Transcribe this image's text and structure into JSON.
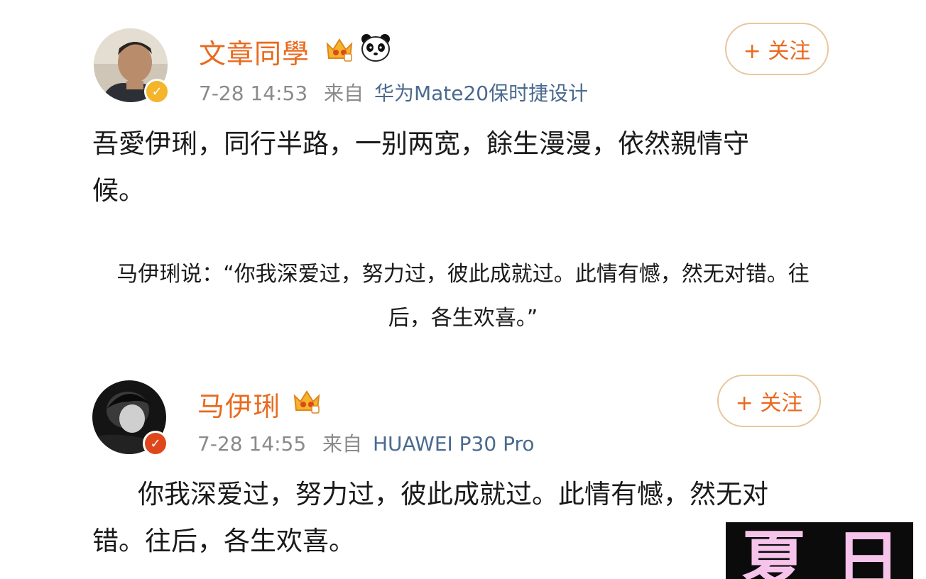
{
  "post1": {
    "username": "文章同學",
    "badges": [
      "crown-member-badge",
      "panda-emoji"
    ],
    "timestamp": "7-28 14:53",
    "from_label": "来自",
    "source": "华为Mate20保时捷设计",
    "follow_label": "+ 关注",
    "text_line1": "吾愛伊琍，同行半路，一别两宽，餘生漫漫，依然親情守",
    "text_line2": "候。",
    "verified_color": "#f4b52a"
  },
  "quote": {
    "line1": "马伊琍说：“你我深爱过，努力过，彼此成就过。此情有憾，然无对错。往",
    "line2": "后，各生欢喜。”"
  },
  "post2": {
    "username": "马伊琍",
    "badges": [
      "crown-member-badge"
    ],
    "timestamp": "7-28 14:55",
    "from_label": "来自",
    "source": "HUAWEI P30 Pro",
    "follow_label": "+ 关注",
    "text_line1": "你我深爱过，努力过，彼此成就过。此情有憾，然无对",
    "text_line2": "错。往后，各生欢喜。",
    "verified_color": "#e0461b"
  },
  "watermark": {
    "text": "夏日"
  },
  "colors": {
    "username": "#e96a1e",
    "meta": "#8a8a8a",
    "source_link": "#4a6a8f",
    "follow_border": "#e8c79e",
    "watermark_fg": "#f6c3ea",
    "watermark_bg": "#0b0b0b"
  }
}
